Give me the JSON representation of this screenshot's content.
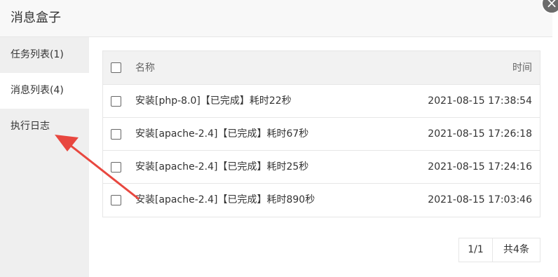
{
  "dialog": {
    "title": "消息盒子",
    "close_icon": "×"
  },
  "sidebar": {
    "items": [
      {
        "label": "任务列表(1)"
      },
      {
        "label": "消息列表(4)"
      },
      {
        "label": "执行日志"
      }
    ],
    "active_index": 1
  },
  "table": {
    "headers": {
      "name": "名称",
      "time": "时间"
    },
    "rows": [
      {
        "name": "安装[php-8.0]【已完成】耗时22秒",
        "time": "2021-08-15 17:38:54"
      },
      {
        "name": "安装[apache-2.4]【已完成】耗时67秒",
        "time": "2021-08-15 17:26:18"
      },
      {
        "name": "安装[apache-2.4]【已完成】耗时25秒",
        "time": "2021-08-15 17:24:16"
      },
      {
        "name": "安装[apache-2.4]【已完成】耗时890秒",
        "time": "2021-08-15 17:03:46"
      }
    ]
  },
  "pagination": {
    "page": "1/1",
    "total": "共4条"
  },
  "colors": {
    "annotation_arrow": "#e8473f",
    "sidebar_bg": "#efefef",
    "header_bg": "#f2f2f2"
  }
}
